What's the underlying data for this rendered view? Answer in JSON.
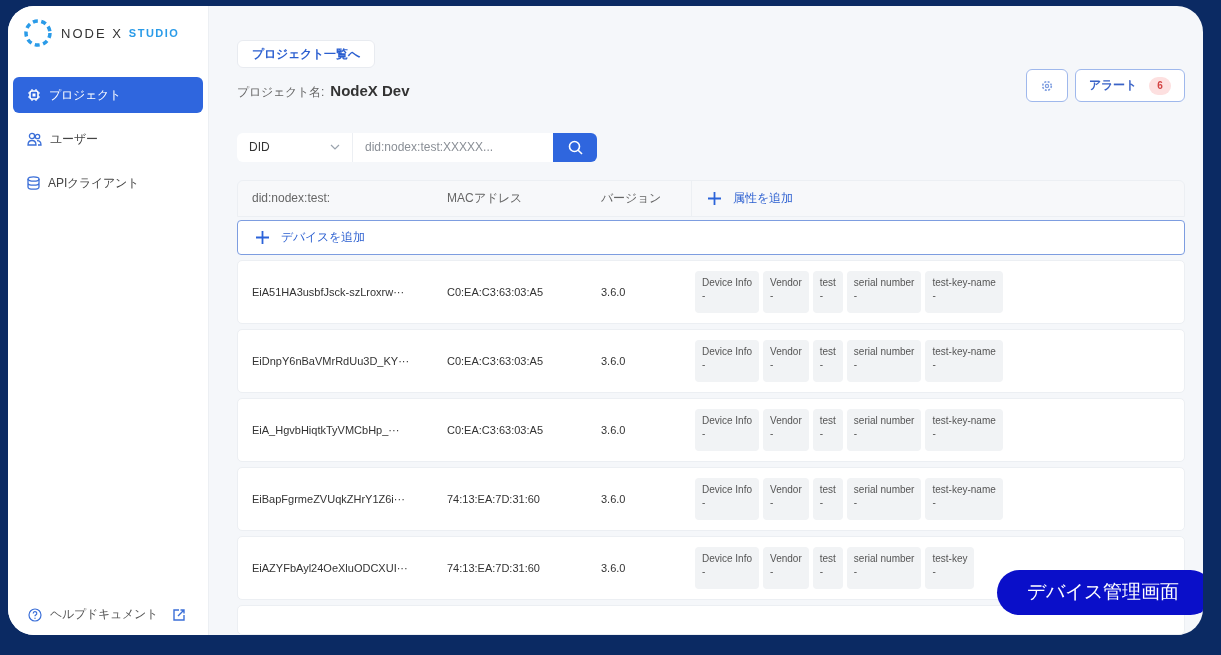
{
  "sidebar": {
    "logo": {
      "text": "NODE X",
      "accent": "STUDIO"
    },
    "items": [
      {
        "label": "プロジェクト",
        "kind": "chip",
        "selected": true
      },
      {
        "label": "ユーザー",
        "kind": "users",
        "selected": false
      },
      {
        "label": "APIクライアント",
        "kind": "database",
        "selected": false
      }
    ],
    "help": "ヘルプドキュメント"
  },
  "header": {
    "back_button": "プロジェクト一覧へ",
    "project_label": "プロジェクト名:",
    "project_name": "NodeX Dev",
    "alert_button": "アラート",
    "alert_count": "6"
  },
  "search": {
    "select": "DID",
    "placeholder": "did:nodex:test:XXXXX..."
  },
  "table": {
    "columns": [
      "did:nodex:test:",
      "MACアドレス",
      "バージョン"
    ],
    "add_attribute": "属性を追加",
    "add_device": "デバイスを追加",
    "rows": [
      {
        "did": "EiA51HA3usbfJsck-szLroxrw···",
        "mac": "C0:EA:C3:63:03:A5",
        "version": "3.6.0",
        "attributes": [
          {
            "name": "Device Info",
            "value": "-"
          },
          {
            "name": "Vendor",
            "value": "-"
          },
          {
            "name": "test",
            "value": "-"
          },
          {
            "name": "serial number",
            "value": "-"
          },
          {
            "name": "test-key-name",
            "value": "-"
          }
        ]
      },
      {
        "did": "EiDnpY6nBaVMrRdUu3D_KY···",
        "mac": "C0:EA:C3:63:03:A5",
        "version": "3.6.0",
        "attributes": [
          {
            "name": "Device Info",
            "value": "-"
          },
          {
            "name": "Vendor",
            "value": "-"
          },
          {
            "name": "test",
            "value": "-"
          },
          {
            "name": "serial number",
            "value": "-"
          },
          {
            "name": "test-key-name",
            "value": "-"
          }
        ]
      },
      {
        "did": "EiA_HgvbHiqtkTyVMCbHp_···",
        "mac": "C0:EA:C3:63:03:A5",
        "version": "3.6.0",
        "attributes": [
          {
            "name": "Device Info",
            "value": "-"
          },
          {
            "name": "Vendor",
            "value": "-"
          },
          {
            "name": "test",
            "value": "-"
          },
          {
            "name": "serial number",
            "value": "-"
          },
          {
            "name": "test-key-name",
            "value": "-"
          }
        ]
      },
      {
        "did": "EiBapFgrmeZVUqkZHrY1Z6i···",
        "mac": "74:13:EA:7D:31:60",
        "version": "3.6.0",
        "attributes": [
          {
            "name": "Device Info",
            "value": "-"
          },
          {
            "name": "Vendor",
            "value": "-"
          },
          {
            "name": "test",
            "value": "-"
          },
          {
            "name": "serial number",
            "value": "-"
          },
          {
            "name": "test-key-name",
            "value": "-"
          }
        ]
      },
      {
        "did": "EiAZYFbAyl24OeXluODCXUI···",
        "mac": "74:13:EA:7D:31:60",
        "version": "3.6.0",
        "attributes": [
          {
            "name": "Device Info",
            "value": "-"
          },
          {
            "name": "Vendor",
            "value": "-"
          },
          {
            "name": "test",
            "value": "-"
          },
          {
            "name": "serial number",
            "value": "-"
          },
          {
            "name": "test-key",
            "value": "-"
          }
        ]
      }
    ]
  },
  "caption": "デバイス管理画面"
}
